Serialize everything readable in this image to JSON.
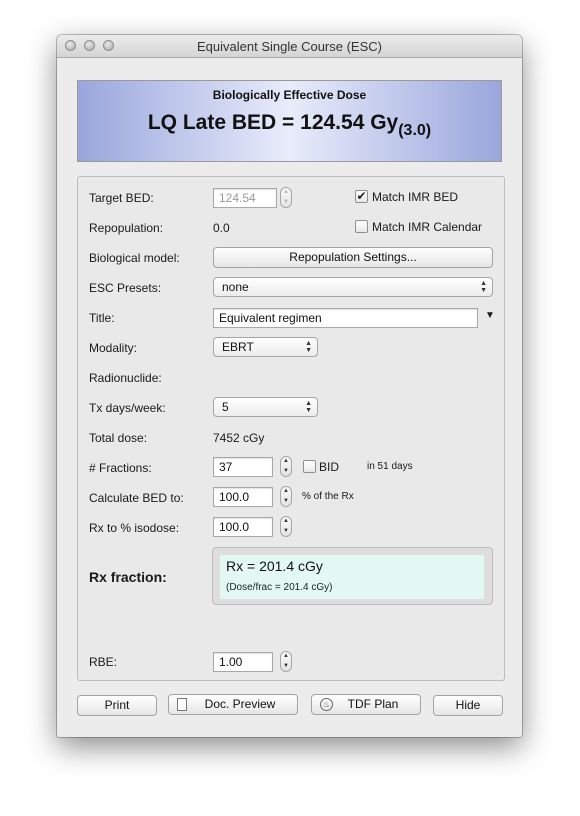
{
  "window": {
    "title": "Equivalent Single Course (ESC)"
  },
  "banner": {
    "subtitle": "Biologically Effective Dose",
    "main_text": "LQ Late BED = 124.54 Gy",
    "sub_value": "(3.0)"
  },
  "form": {
    "target_bed_label": "Target BED:",
    "target_bed_value": "124.54",
    "match_imr_bed_label": "Match IMR BED",
    "match_imr_bed_checked": true,
    "repopulation_label": "Repopulation:",
    "repopulation_value": "0.0",
    "match_imr_calendar_label": "Match IMR Calendar",
    "match_imr_calendar_checked": false,
    "bio_model_label": "Biological model:",
    "repop_settings_button": "Repopulation Settings...",
    "esc_presets_label": "ESC Presets:",
    "esc_presets_value": "none",
    "title_label": "Title:",
    "title_value": "Equivalent regimen",
    "modality_label": "Modality:",
    "modality_value": "EBRT",
    "radionuclide_label": "Radionuclide:",
    "tx_days_label": "Tx days/week:",
    "tx_days_value": "5",
    "total_dose_label": "Total dose:",
    "total_dose_value": "7452 cGy",
    "fractions_label": "# Fractions:",
    "fractions_value": "37",
    "bid_label": "BID",
    "bid_checked": false,
    "days_text": "in 51 days",
    "calc_bed_label": "Calculate BED to:",
    "calc_bed_value": "100.0",
    "calc_bed_suffix": "% of the Rx",
    "rx_isodose_label": "Rx to % isodose:",
    "rx_isodose_value": "100.0",
    "rx_fraction_label": "Rx fraction:",
    "rx_main": "Rx = 201.4 cGy",
    "rx_sub": "(Dose/frac = 201.4 cGy)",
    "rbe_label": "RBE:",
    "rbe_value": "1.00"
  },
  "buttons": {
    "print": "Print",
    "doc_preview": "Doc. Preview",
    "tdf_plan": "TDF Plan",
    "hide": "Hide"
  },
  "colors": {
    "banner_edge": "#9aa6dc",
    "banner_center": "#e8ecfb",
    "rx_panel_bg": "#e3f8f2"
  }
}
